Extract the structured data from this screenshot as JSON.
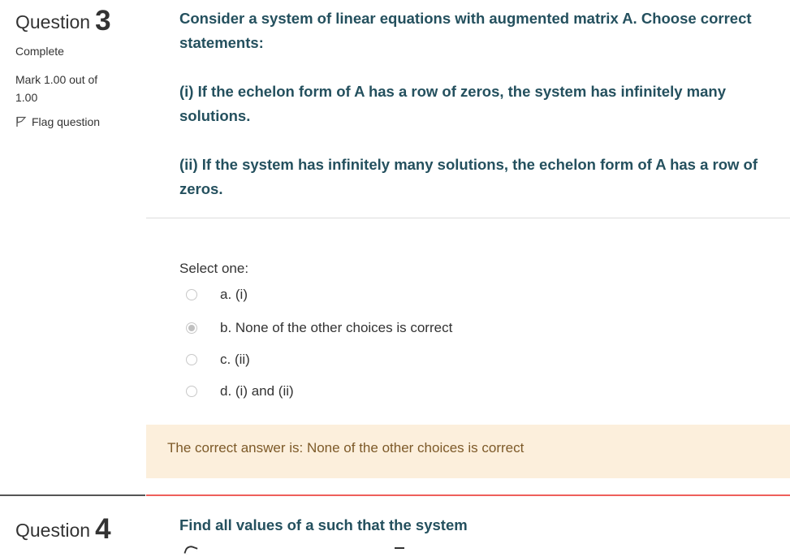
{
  "question3": {
    "label": "Question",
    "number": "3",
    "state": "Complete",
    "grade": "Mark 1.00 out of 1.00",
    "flag_label": "Flag question",
    "text": [
      "Consider a system of linear equations with augmented matrix A. Choose correct statements:",
      "(i) If the echelon form of A has a row of zeros, the system has infinitely many solutions.",
      "(ii) If the system has infinitely many solutions, the echelon form of A has a row of zeros."
    ],
    "prompt": "Select one:",
    "options": [
      {
        "label": "a. (i)",
        "selected": false
      },
      {
        "label": "b. None of the other choices is correct",
        "selected": true
      },
      {
        "label": "c. (ii)",
        "selected": false
      },
      {
        "label": "d. (i) and (ii)",
        "selected": false
      }
    ],
    "feedback": "The correct answer is: None of the other choices is correct"
  },
  "question4": {
    "label": "Question",
    "number": "4",
    "text": "Find all values of a such that the system"
  },
  "colors": {
    "question_text": "#24505e",
    "feedback_bg": "#fcefdc",
    "feedback_text": "#7d5a29",
    "divider_accent": "#ee5f5b"
  }
}
